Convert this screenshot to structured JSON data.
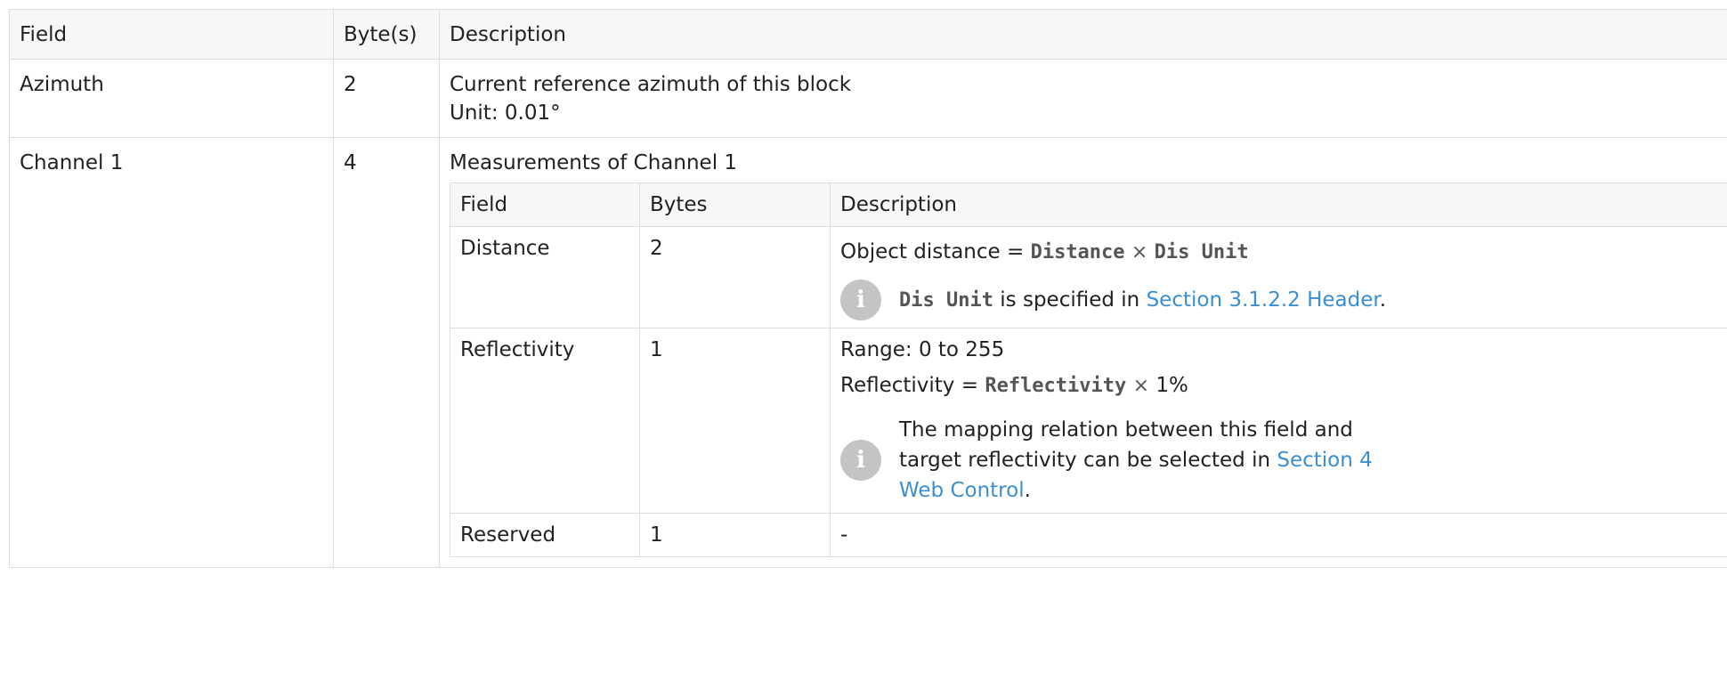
{
  "outer": {
    "headers": [
      "Field",
      "Byte(s)",
      "Description"
    ],
    "rows": [
      {
        "field": "Azimuth",
        "bytes": "2",
        "desc_line1": "Current reference azimuth of this block",
        "desc_line2": "Unit: 0.01°"
      },
      {
        "field": "Channel 1",
        "bytes": "4",
        "desc_line1": "Measurements of Channel 1"
      }
    ]
  },
  "inner": {
    "headers": [
      "Field",
      "Bytes",
      "Description"
    ],
    "distance": {
      "field": "Distance",
      "bytes": "2",
      "formula_prefix": "Object distance = ",
      "formula_var1": "Distance",
      "times": "×",
      "formula_var2": "Dis Unit",
      "note_code": "Dis Unit",
      "note_text": " is specified in ",
      "note_link": "Section 3.1.2.2 Header",
      "note_end": "."
    },
    "reflectivity": {
      "field": "Reflectivity",
      "bytes": "1",
      "range": "Range: 0 to 255",
      "formula_prefix": "Reflectivity = ",
      "formula_var": "Reflectivity",
      "times": "×",
      "formula_suffix": " 1%",
      "note_text": "The mapping relation between this field and target reflectivity can be selected in ",
      "note_link": "Section 4 Web Control",
      "note_end": "."
    },
    "reserved": {
      "field": "Reserved",
      "bytes": "1",
      "desc": "-"
    }
  },
  "icons": {
    "note": "info-icon",
    "note_glyph": "i"
  }
}
